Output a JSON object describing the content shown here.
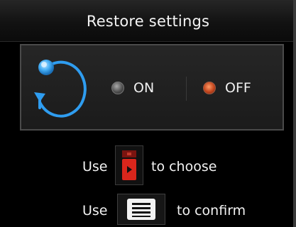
{
  "dialog": {
    "title": "Restore settings"
  },
  "options": [
    {
      "label": "ON",
      "selected": false
    },
    {
      "label": "OFF",
      "selected": true
    }
  ],
  "instructions": {
    "choose": {
      "prefix": "Use",
      "suffix": "to choose",
      "icon": "remote-arrow-key-icon"
    },
    "confirm": {
      "prefix": "Use",
      "suffix": "to confirm",
      "icon": "menu-key-icon"
    }
  },
  "colors": {
    "accent_blue": "#2f9df0",
    "selected_red": "#d04a20",
    "key_red": "#d9261c"
  },
  "icons": {
    "restore": "restore-circular-arrow-icon"
  }
}
